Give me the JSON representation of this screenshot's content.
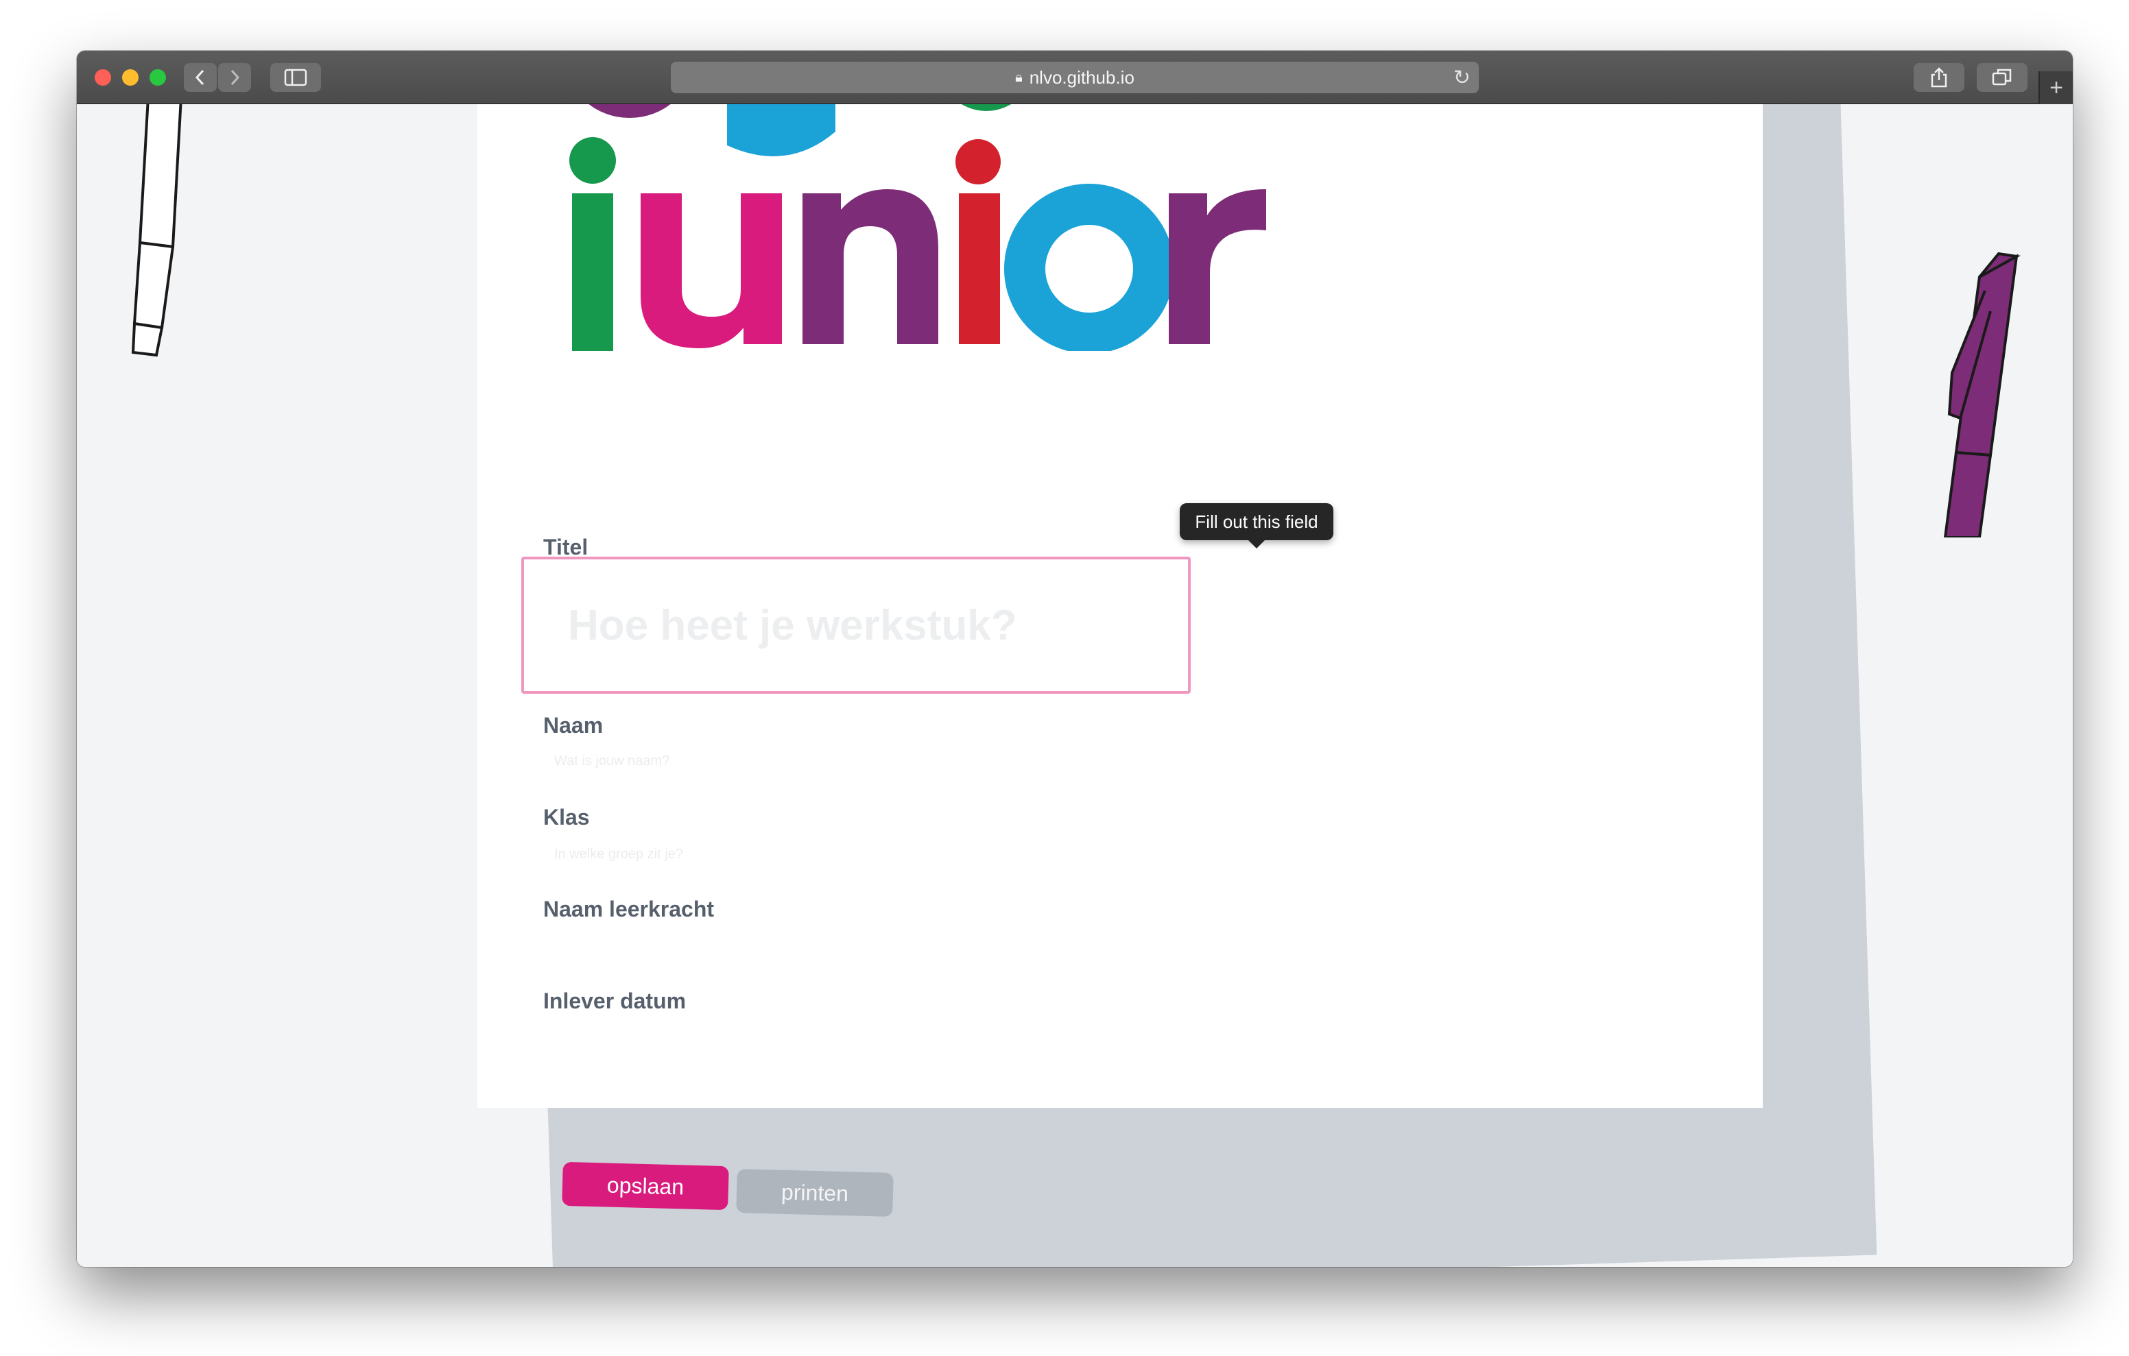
{
  "browser": {
    "url": "nlvo.github.io",
    "tab_plus": "+"
  },
  "form": {
    "title_label": "Titel",
    "title_placeholder": "Hoe heet je werkstuk?",
    "name_label": "Naam",
    "name_placeholder": "Wat is jouw naam?",
    "class_label": "Klas",
    "class_placeholder": "In welke groep zit je?",
    "teacher_label": "Naam leerkracht",
    "date_label": "Inlever datum"
  },
  "tooltip": "Fill out this field",
  "buttons": {
    "save": "opslaan",
    "print": "printen"
  },
  "logo": {
    "word": "junior",
    "colors": [
      "#17994d",
      "#d91b7d",
      "#7d2c77",
      "#d3222e",
      "#1ba3d8",
      "#7d2c77"
    ]
  }
}
